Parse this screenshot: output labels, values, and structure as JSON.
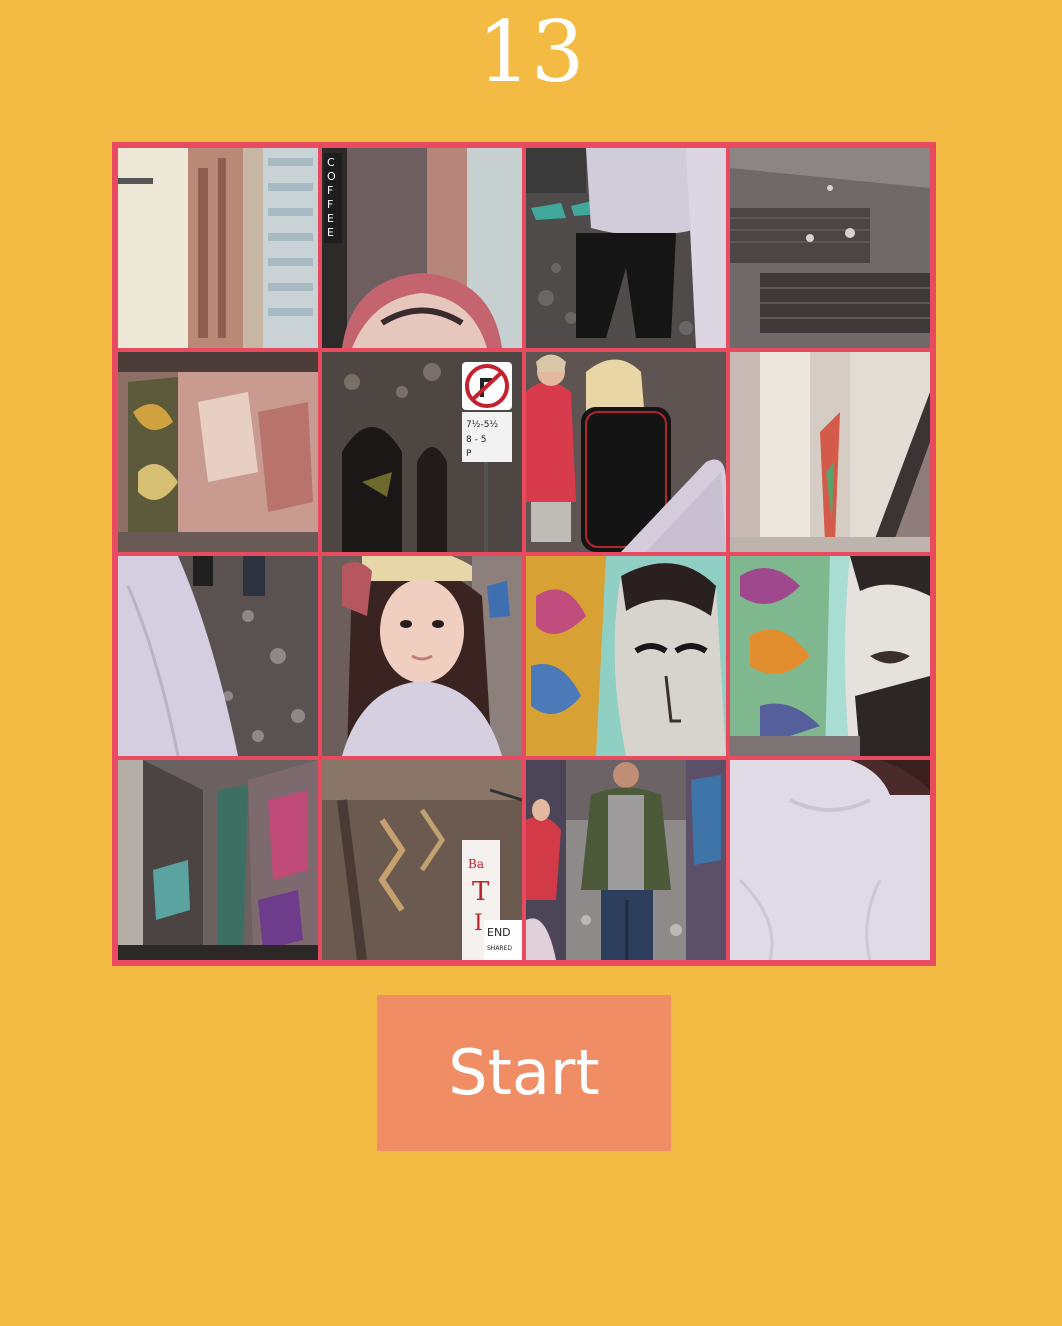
{
  "game": {
    "counter": "13",
    "start_label": "Start",
    "colors": {
      "background": "#F4BB44",
      "board_border": "#E84A5F",
      "button": "#F08D64",
      "text": "#FFFFFF"
    }
  },
  "tiles": [
    {
      "scene": "building-facade"
    },
    {
      "scene": "coffee-sign-pink-cap"
    },
    {
      "scene": "legs-walking"
    },
    {
      "scene": "wet-cobblestone-grate"
    },
    {
      "scene": "graffiti-wall-pink"
    },
    {
      "scene": "archway-no-turn-sign"
    },
    {
      "scene": "crowd-backpack"
    },
    {
      "scene": "graffiti-wall-light"
    },
    {
      "scene": "sleeve-cobblestone"
    },
    {
      "scene": "girl-face"
    },
    {
      "scene": "mural-face-eyes"
    },
    {
      "scene": "mural-face-lips"
    },
    {
      "scene": "graffiti-laneway"
    },
    {
      "scene": "brick-wall-sign"
    },
    {
      "scene": "man-walking-lane"
    },
    {
      "scene": "lavender-shirt"
    }
  ]
}
